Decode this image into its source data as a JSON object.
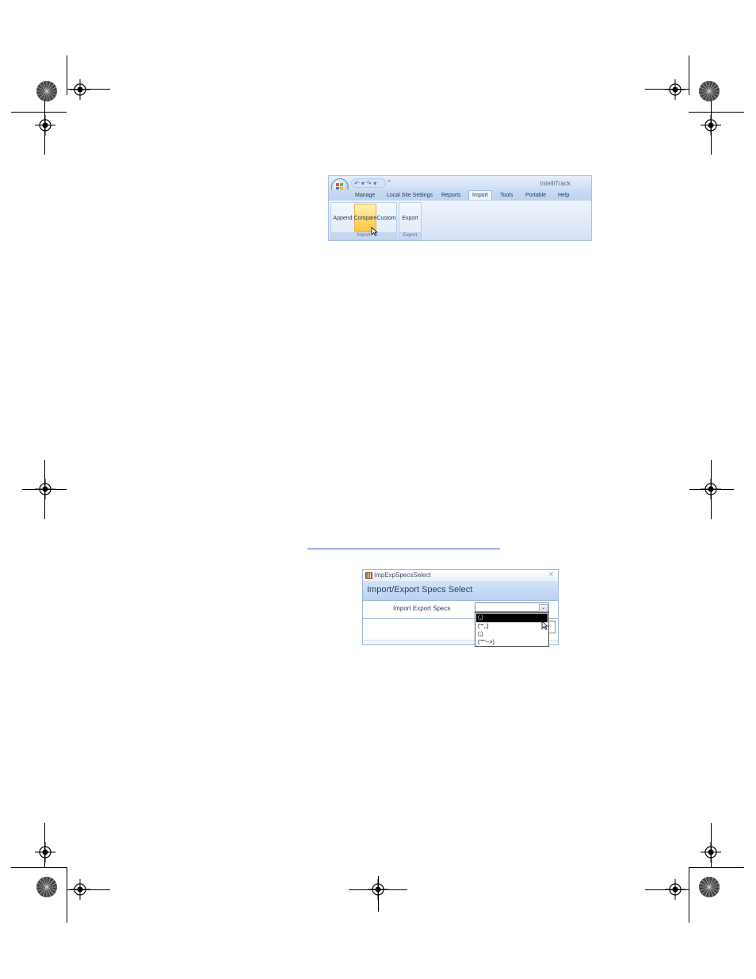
{
  "ribbon": {
    "app_title": "IntelliTrack",
    "qat_glyphs": "↶ ▾ ↷ ▾",
    "qat_more": "⁼",
    "tabs": [
      "Manage",
      "Local Site Settings",
      "Reports",
      "Import",
      "Tools",
      "Portable",
      "Help"
    ],
    "active_tab": "Import",
    "groups": {
      "import": {
        "label": "Import",
        "buttons": [
          "Append",
          "Compare",
          "Custom"
        ]
      },
      "export": {
        "label": "Export",
        "buttons": [
          "Export"
        ]
      }
    },
    "highlighted_button": "Compare"
  },
  "dialog": {
    "window_title": "ImpExpSpecsSelect",
    "close_glyph": "✕",
    "header": "Import/Export Specs Select",
    "field_label": "Import Export Specs",
    "combo_value": "",
    "combo_arrow": "⌄",
    "options": [
      "(,)",
      "(\"\",;)",
      "(;)",
      "(\"\"\"-->)"
    ],
    "selected_option_index": 0
  }
}
